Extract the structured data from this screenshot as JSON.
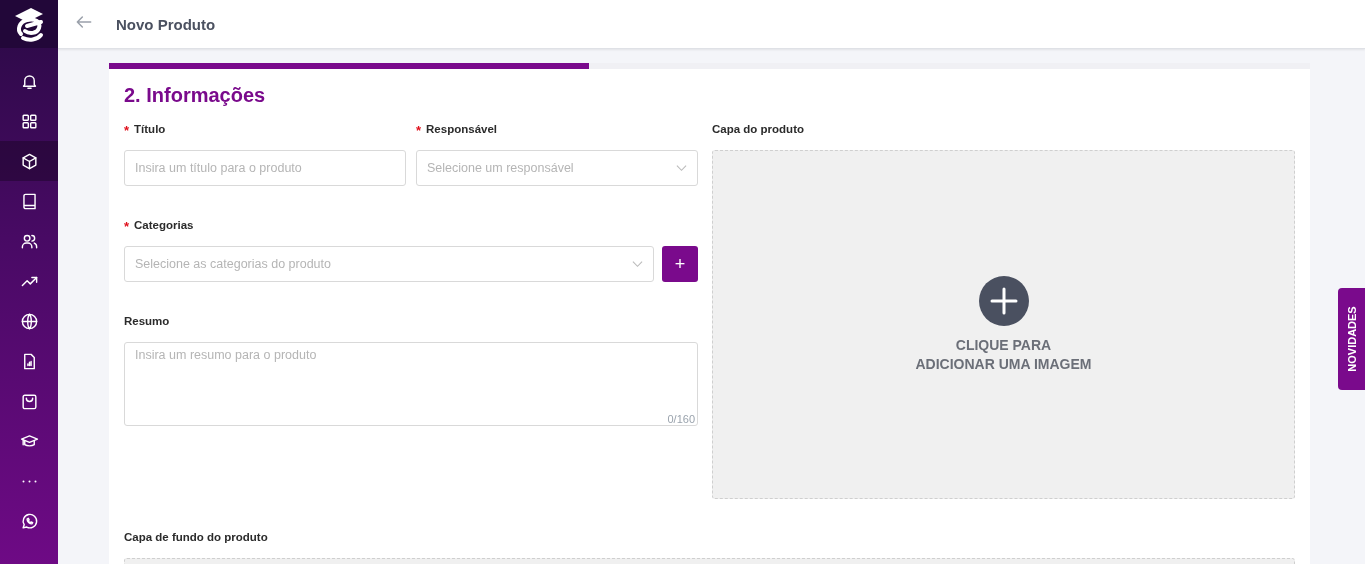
{
  "sidebar": {
    "items": [
      {
        "kind": "bell",
        "selected": false
      },
      {
        "kind": "grid",
        "selected": false
      },
      {
        "kind": "cube",
        "selected": true
      },
      {
        "kind": "book",
        "selected": false
      },
      {
        "kind": "users",
        "selected": false
      },
      {
        "kind": "trend",
        "selected": false
      },
      {
        "kind": "globe",
        "selected": false
      },
      {
        "kind": "report",
        "selected": false
      },
      {
        "kind": "bag",
        "selected": false
      },
      {
        "kind": "cap",
        "selected": false
      },
      {
        "kind": "more",
        "selected": false
      },
      {
        "kind": "whatsapp",
        "selected": false
      }
    ]
  },
  "header": {
    "title": "Novo Produto"
  },
  "progress": {
    "level": 0.4
  },
  "section_title": "2. Informações",
  "fields": {
    "title": {
      "label": "Título",
      "marker": "*",
      "placeholder": "Insira um título para o produto"
    },
    "responsible": {
      "label": "Responsável",
      "marker": "*",
      "placeholder": "Selecione um responsável"
    },
    "categories": {
      "label": "Categorias",
      "marker": "*",
      "placeholder": "Selecione as categorias do produto",
      "add_button": "+"
    },
    "summary": {
      "label": "Resumo",
      "placeholder": "Insira um resumo para o produto",
      "counter": "0/160"
    }
  },
  "cover": {
    "label": "Capa do produto",
    "lines": [
      "CLIQUE PARA",
      "ADICIONAR UMA IMAGEM"
    ]
  },
  "background_cover": {
    "label": "Capa de fundo do produto"
  },
  "news_tab": "NOVIDADES"
}
